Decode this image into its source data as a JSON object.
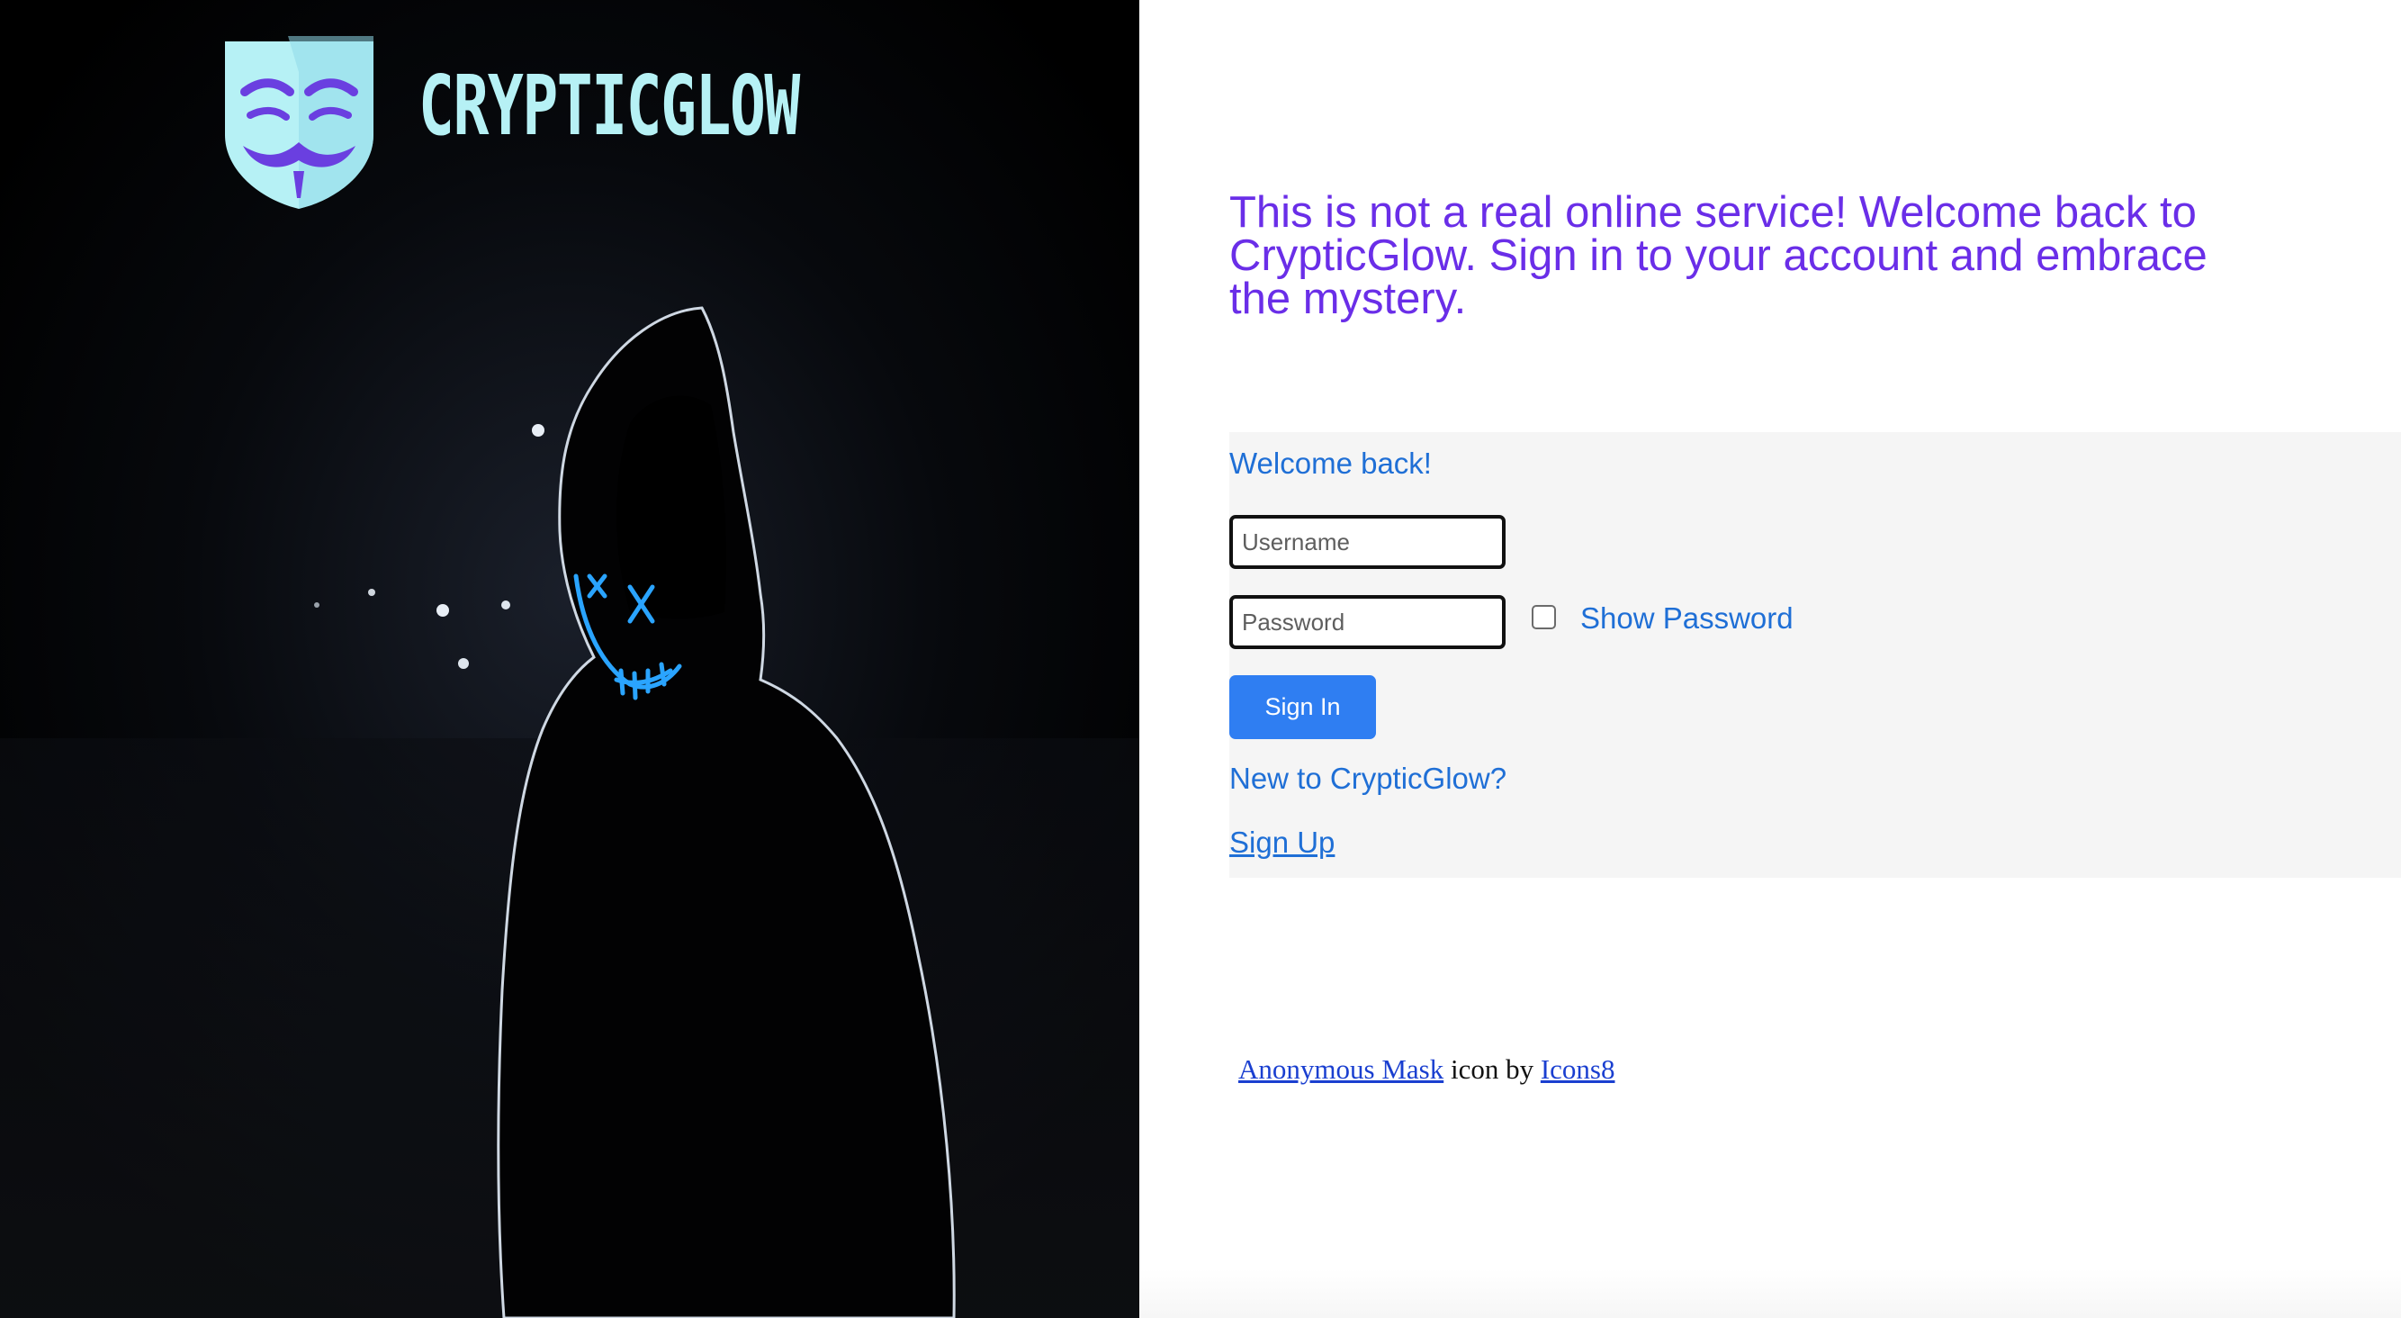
{
  "brand": {
    "name": "CRYPTICGLOW",
    "logo_icon": "anonymous-mask-icon"
  },
  "hero": {
    "image": "hooded-figure-glowing-mask"
  },
  "headline": "This is not a real online service! Welcome back to CrypticGlow. Sign in to your account and embrace the mystery.",
  "form": {
    "welcome": "Welcome back!",
    "username_placeholder": "Username",
    "password_placeholder": "Password",
    "show_password_label": "Show Password",
    "show_password_checked": false,
    "signin_label": "Sign In",
    "new_prompt": "New to CrypticGlow?",
    "signup_label": "Sign Up"
  },
  "attribution": {
    "mask_link": "Anonymous Mask",
    "middle_text": "icon by",
    "icons8_link": "Icons8"
  },
  "colors": {
    "headline": "#6a2ee8",
    "link": "#1f6fd6",
    "button": "#2f7ef2",
    "logo": "#b6f1f5",
    "mask_glow": "#2aa4ff"
  }
}
